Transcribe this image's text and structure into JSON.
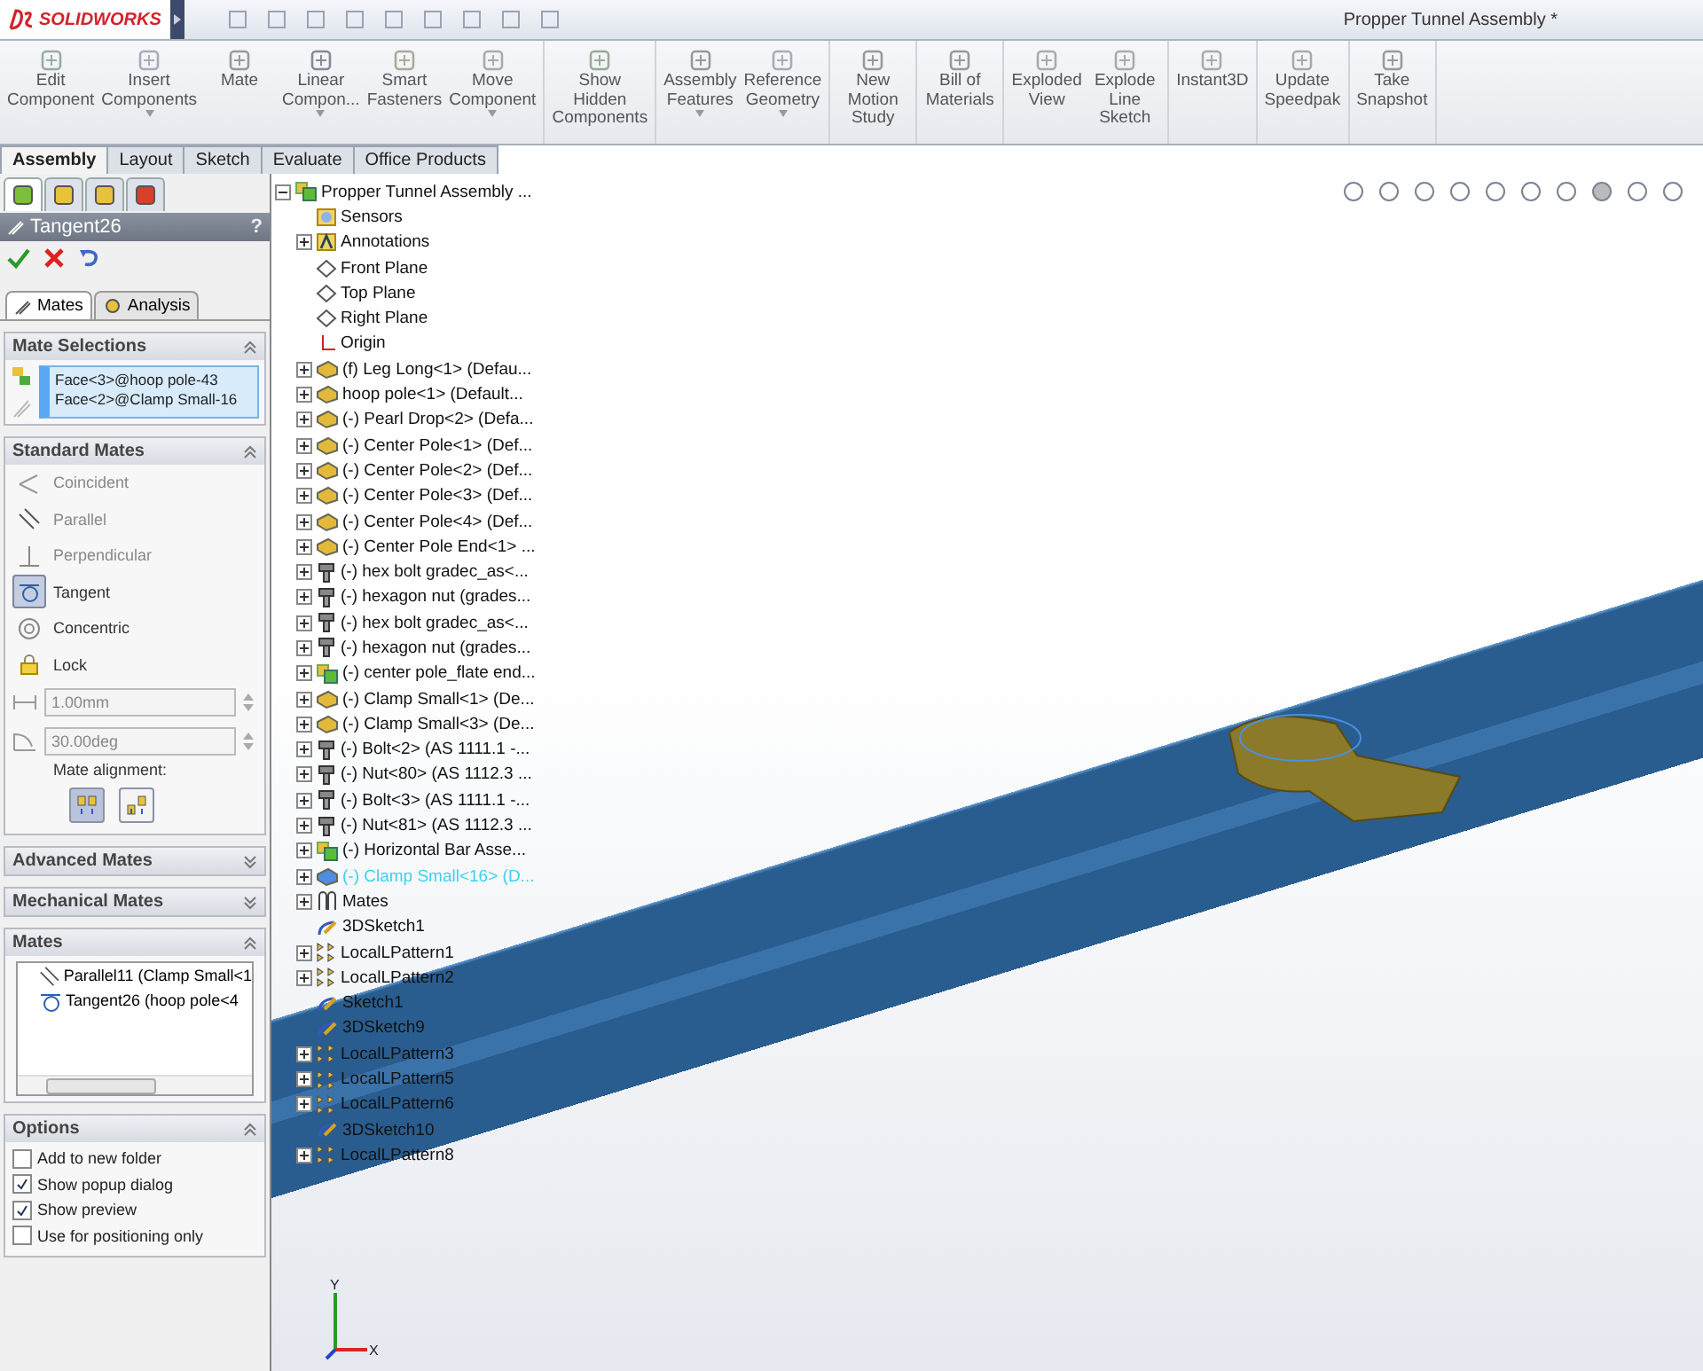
{
  "app": {
    "logo_text": "SOLIDWORKS",
    "title": "Propper Tunnel Assembly *"
  },
  "ribbon": {
    "groups": [
      {
        "buttons": [
          {
            "lines": [
              "Edit",
              "Component"
            ],
            "kind": "edit",
            "has_menu": false
          },
          {
            "lines": [
              "Insert",
              "Components"
            ],
            "kind": "insert",
            "has_menu": true
          },
          {
            "lines": [
              "Mate"
            ],
            "kind": "mate",
            "has_menu": false
          },
          {
            "lines": [
              "Linear",
              "Compon..."
            ],
            "kind": "pattern",
            "has_menu": true
          },
          {
            "lines": [
              "Smart",
              "Fasteners"
            ],
            "kind": "fastener",
            "has_menu": false
          },
          {
            "lines": [
              "Move",
              "Component"
            ],
            "kind": "move",
            "has_menu": true
          }
        ]
      },
      {
        "buttons": [
          {
            "lines": [
              "Show",
              "Hidden",
              "Components"
            ],
            "kind": "show",
            "has_menu": false
          }
        ]
      },
      {
        "buttons": [
          {
            "lines": [
              "Assembly",
              "Features"
            ],
            "kind": "features",
            "has_menu": true
          },
          {
            "lines": [
              "Reference",
              "Geometry"
            ],
            "kind": "geometry",
            "has_menu": true
          }
        ]
      },
      {
        "buttons": [
          {
            "lines": [
              "New",
              "Motion",
              "Study"
            ],
            "kind": "motion",
            "has_menu": false
          }
        ]
      },
      {
        "buttons": [
          {
            "lines": [
              "Bill of",
              "Materials"
            ],
            "kind": "bom",
            "has_menu": false
          }
        ]
      },
      {
        "buttons": [
          {
            "lines": [
              "Exploded",
              "View"
            ],
            "kind": "explode",
            "has_menu": false
          },
          {
            "lines": [
              "Explode",
              "Line",
              "Sketch"
            ],
            "kind": "explode",
            "has_menu": false
          }
        ]
      },
      {
        "buttons": [
          {
            "lines": [
              "Instant3D"
            ],
            "kind": "instant",
            "has_menu": false
          }
        ]
      },
      {
        "buttons": [
          {
            "lines": [
              "Update",
              "Speedpak"
            ],
            "kind": "update",
            "has_menu": false
          }
        ]
      },
      {
        "buttons": [
          {
            "lines": [
              "Take",
              "Snapshot"
            ],
            "kind": "snapshot",
            "has_menu": false
          }
        ]
      }
    ]
  },
  "tabs": [
    {
      "label": "Assembly",
      "selected": true
    },
    {
      "label": "Layout",
      "selected": false
    },
    {
      "label": "Sketch",
      "selected": false
    },
    {
      "label": "Evaluate",
      "selected": false
    },
    {
      "label": "Office Products",
      "selected": false
    }
  ],
  "panel": {
    "manager_tabs": [
      {
        "kind": "tree",
        "selected": true
      },
      {
        "kind": "property",
        "selected": false
      },
      {
        "kind": "config",
        "selected": false
      },
      {
        "kind": "display",
        "selected": false
      }
    ],
    "title": "Tangent26",
    "help": "?",
    "sub_tabs": [
      {
        "label": "Mates",
        "kind": "mates",
        "selected": true
      },
      {
        "label": "Analysis",
        "kind": "analysis",
        "selected": false
      }
    ],
    "mate_selections": {
      "title": "Mate Selections",
      "expanded": true,
      "items": [
        "Face<3>@hoop pole-43",
        "Face<2>@Clamp Small-16"
      ]
    },
    "standard_mates": {
      "title": "Standard Mates",
      "expanded": true,
      "items": [
        {
          "label": "Coincident",
          "kind": "coincident",
          "selected": false,
          "disabled": true
        },
        {
          "label": "Parallel",
          "kind": "parallel",
          "selected": false,
          "disabled": true
        },
        {
          "label": "Perpendicular",
          "kind": "perpendicular",
          "selected": false,
          "disabled": true
        },
        {
          "label": "Tangent",
          "kind": "tangent",
          "selected": true,
          "disabled": false
        },
        {
          "label": "Concentric",
          "kind": "concentric",
          "selected": false,
          "disabled": false
        },
        {
          "label": "Lock",
          "kind": "lock",
          "selected": false,
          "disabled": false
        }
      ],
      "distance": "1.00mm",
      "angle": "30.00deg",
      "alignment_label": "Mate alignment:",
      "alignment": [
        {
          "kind": "aligned",
          "selected": true
        },
        {
          "kind": "anti",
          "selected": false
        }
      ]
    },
    "advanced": {
      "title": "Advanced Mates",
      "expanded": false
    },
    "mechanical": {
      "title": "Mechanical Mates",
      "expanded": false
    },
    "mates": {
      "title": "Mates",
      "expanded": true,
      "items": [
        {
          "label": "Parallel11 (Clamp Small<1",
          "kind": "parallel"
        },
        {
          "label": "Tangent26 (hoop pole<4",
          "kind": "tangent"
        }
      ]
    },
    "options": {
      "title": "Options",
      "expanded": true,
      "items": [
        {
          "label": "Add to new folder",
          "checked": false
        },
        {
          "label": "Show popup dialog",
          "checked": true
        },
        {
          "label": "Show preview",
          "checked": true
        },
        {
          "label": "Use for positioning only",
          "checked": false
        }
      ]
    }
  },
  "tree": {
    "label": "Propper Tunnel Assembly ...",
    "kind": "assembly",
    "expanded": true,
    "children": [
      {
        "label": "Sensors",
        "kind": "sensor",
        "expandable": false,
        "highlighted": false
      },
      {
        "label": "Annotations",
        "kind": "annotation",
        "expandable": true,
        "highlighted": false
      },
      {
        "label": "Front Plane",
        "kind": "plane",
        "expandable": false,
        "highlighted": false
      },
      {
        "label": "Top Plane",
        "kind": "plane",
        "expandable": false,
        "highlighted": false
      },
      {
        "label": "Right Plane",
        "kind": "plane",
        "expandable": false,
        "highlighted": false
      },
      {
        "label": "Origin",
        "kind": "origin",
        "expandable": false,
        "highlighted": false
      },
      {
        "label": "(f) Leg Long<1> (Defau...",
        "kind": "part",
        "expandable": true,
        "highlighted": false
      },
      {
        "label": "hoop pole<1> (Default...",
        "kind": "part",
        "expandable": true,
        "highlighted": false
      },
      {
        "label": "(-) Pearl Drop<2> (Defa...",
        "kind": "part",
        "expandable": true,
        "highlighted": false
      },
      {
        "label": "(-) Center Pole<1> (Def...",
        "kind": "part",
        "expandable": true,
        "highlighted": false
      },
      {
        "label": "(-) Center Pole<2> (Def...",
        "kind": "part",
        "expandable": true,
        "highlighted": false
      },
      {
        "label": "(-) Center Pole<3> (Def...",
        "kind": "part",
        "expandable": true,
        "highlighted": false
      },
      {
        "label": "(-) Center Pole<4> (Def...",
        "kind": "part",
        "expandable": true,
        "highlighted": false
      },
      {
        "label": "(-) Center Pole End<1> ...",
        "kind": "part",
        "expandable": true,
        "highlighted": false
      },
      {
        "label": "(-) hex bolt gradec_as<...",
        "kind": "bolt",
        "expandable": true,
        "highlighted": false
      },
      {
        "label": "(-) hexagon nut (grades...",
        "kind": "bolt",
        "expandable": true,
        "highlighted": false
      },
      {
        "label": "(-) hex bolt gradec_as<...",
        "kind": "bolt",
        "expandable": true,
        "highlighted": false
      },
      {
        "label": "(-) hexagon nut (grades...",
        "kind": "bolt",
        "expandable": true,
        "highlighted": false
      },
      {
        "label": "(-) center pole_flate end...",
        "kind": "subassembly",
        "expandable": true,
        "highlighted": false
      },
      {
        "label": "(-) Clamp Small<1> (De...",
        "kind": "part",
        "expandable": true,
        "highlighted": false
      },
      {
        "label": "(-) Clamp Small<3> (De...",
        "kind": "part",
        "expandable": true,
        "highlighted": false
      },
      {
        "label": "(-) Bolt<2> (AS 1111.1 -...",
        "kind": "bolt",
        "expandable": true,
        "highlighted": false
      },
      {
        "label": "(-) Nut<80> (AS 1112.3 ...",
        "kind": "bolt",
        "expandable": true,
        "highlighted": false
      },
      {
        "label": "(-) Bolt<3> (AS 1111.1 -...",
        "kind": "bolt",
        "expandable": true,
        "highlighted": false
      },
      {
        "label": "(-) Nut<81> (AS 1112.3 ...",
        "kind": "bolt",
        "expandable": true,
        "highlighted": false
      },
      {
        "label": "(-) Horizontal Bar Asse...",
        "kind": "subassembly",
        "expandable": true,
        "highlighted": false
      },
      {
        "label": "(-) Clamp Small<16> (D...",
        "kind": "selected-part",
        "expandable": true,
        "highlighted": true
      },
      {
        "label": "Mates",
        "kind": "mates",
        "expandable": true,
        "highlighted": false
      },
      {
        "label": "3DSketch1",
        "kind": "sketch3d",
        "expandable": false,
        "highlighted": false
      },
      {
        "label": "LocalLPattern1",
        "kind": "pattern",
        "expandable": true,
        "highlighted": false
      },
      {
        "label": "LocalLPattern2",
        "kind": "pattern",
        "expandable": true,
        "highlighted": false
      },
      {
        "label": "Sketch1",
        "kind": "sketch",
        "expandable": false,
        "highlighted": false
      },
      {
        "label": "3DSketch9",
        "kind": "sketch3d",
        "expandable": false,
        "highlighted": false
      },
      {
        "label": "LocalLPattern3",
        "kind": "pattern",
        "expandable": true,
        "highlighted": false
      },
      {
        "label": "LocalLPattern5",
        "kind": "pattern",
        "expandable": true,
        "highlighted": false
      },
      {
        "label": "LocalLPattern6",
        "kind": "pattern",
        "expandable": true,
        "highlighted": false
      },
      {
        "label": "3DSketch10",
        "kind": "sketch3d",
        "expandable": false,
        "highlighted": false
      },
      {
        "label": "LocalLPattern8",
        "kind": "pattern",
        "expandable": true,
        "highlighted": false
      }
    ]
  },
  "triad": {
    "vertical": "Y",
    "horizontal": "X"
  }
}
